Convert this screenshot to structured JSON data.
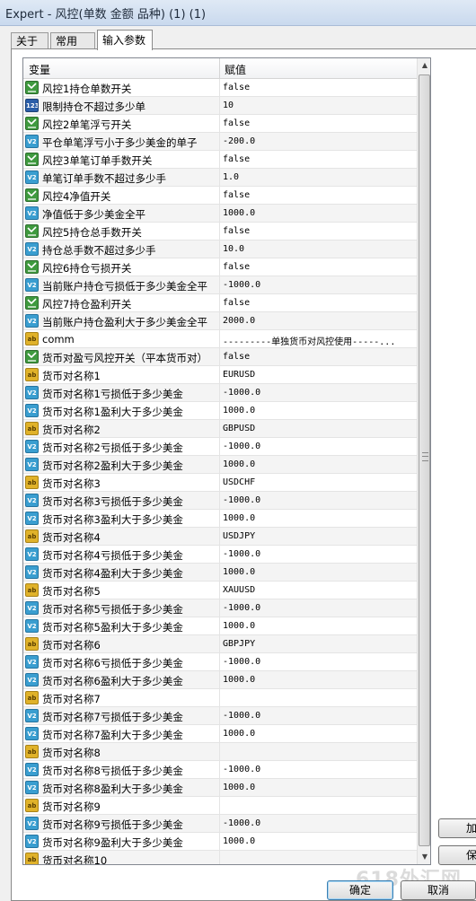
{
  "window": {
    "title": "Expert - 风控(单数 金额 品种) (1) (1)"
  },
  "tabs": [
    "关于",
    "常用",
    "输入参数"
  ],
  "table": {
    "col_variable": "变量",
    "col_value": "赋值",
    "rows": [
      {
        "type": "bool",
        "name": "风控1持仓单数开关",
        "value": "false"
      },
      {
        "type": "int",
        "name": "限制持仓不超过多少单",
        "value": "10"
      },
      {
        "type": "bool",
        "name": "风控2单笔浮亏开关",
        "value": "false"
      },
      {
        "type": "dbl",
        "name": "平仓单笔浮亏小于多少美金的单子",
        "value": "-200.0"
      },
      {
        "type": "bool",
        "name": "风控3单笔订单手数开关",
        "value": "false"
      },
      {
        "type": "dbl",
        "name": "单笔订单手数不超过多少手",
        "value": "1.0"
      },
      {
        "type": "bool",
        "name": "风控4净值开关",
        "value": "false"
      },
      {
        "type": "dbl",
        "name": "净值低于多少美金全平",
        "value": "1000.0"
      },
      {
        "type": "bool",
        "name": "风控5持仓总手数开关",
        "value": "false"
      },
      {
        "type": "dbl",
        "name": "持仓总手数不超过多少手",
        "value": "10.0"
      },
      {
        "type": "bool",
        "name": "风控6持仓亏损开关",
        "value": "false"
      },
      {
        "type": "dbl",
        "name": "当前账户持仓亏损低于多少美金全平",
        "value": "-1000.0"
      },
      {
        "type": "bool",
        "name": "风控7持仓盈利开关",
        "value": "false"
      },
      {
        "type": "dbl",
        "name": "当前账户持仓盈利大于多少美金全平",
        "value": "2000.0"
      },
      {
        "type": "str",
        "name": "comm",
        "value": "---------单独货币对风控使用-----..."
      },
      {
        "type": "bool",
        "name": "货币对盈亏风控开关（平本货币对）",
        "value": "false"
      },
      {
        "type": "str",
        "name": "货币对名称1",
        "value": "EURUSD"
      },
      {
        "type": "dbl",
        "name": "货币对名称1亏损低于多少美金",
        "value": "-1000.0"
      },
      {
        "type": "dbl",
        "name": "货币对名称1盈利大于多少美金",
        "value": "1000.0"
      },
      {
        "type": "str",
        "name": "货币对名称2",
        "value": "GBPUSD"
      },
      {
        "type": "dbl",
        "name": "货币对名称2亏损低于多少美金",
        "value": "-1000.0"
      },
      {
        "type": "dbl",
        "name": "货币对名称2盈利大于多少美金",
        "value": "1000.0"
      },
      {
        "type": "str",
        "name": "货币对名称3",
        "value": "USDCHF"
      },
      {
        "type": "dbl",
        "name": "货币对名称3亏损低于多少美金",
        "value": "-1000.0"
      },
      {
        "type": "dbl",
        "name": "货币对名称3盈利大于多少美金",
        "value": "1000.0"
      },
      {
        "type": "str",
        "name": "货币对名称4",
        "value": "USDJPY"
      },
      {
        "type": "dbl",
        "name": "货币对名称4亏损低于多少美金",
        "value": "-1000.0"
      },
      {
        "type": "dbl",
        "name": "货币对名称4盈利大于多少美金",
        "value": "1000.0"
      },
      {
        "type": "str",
        "name": "货币对名称5",
        "value": "XAUUSD"
      },
      {
        "type": "dbl",
        "name": "货币对名称5亏损低于多少美金",
        "value": "-1000.0"
      },
      {
        "type": "dbl",
        "name": "货币对名称5盈利大于多少美金",
        "value": "1000.0"
      },
      {
        "type": "str",
        "name": "货币对名称6",
        "value": "GBPJPY"
      },
      {
        "type": "dbl",
        "name": "货币对名称6亏损低于多少美金",
        "value": "-1000.0"
      },
      {
        "type": "dbl",
        "name": "货币对名称6盈利大于多少美金",
        "value": "1000.0"
      },
      {
        "type": "str",
        "name": "货币对名称7",
        "value": ""
      },
      {
        "type": "dbl",
        "name": "货币对名称7亏损低于多少美金",
        "value": "-1000.0"
      },
      {
        "type": "dbl",
        "name": "货币对名称7盈利大于多少美金",
        "value": "1000.0"
      },
      {
        "type": "str",
        "name": "货币对名称8",
        "value": ""
      },
      {
        "type": "dbl",
        "name": "货币对名称8亏损低于多少美金",
        "value": "-1000.0"
      },
      {
        "type": "dbl",
        "name": "货币对名称8盈利大于多少美金",
        "value": "1000.0"
      },
      {
        "type": "str",
        "name": "货币对名称9",
        "value": ""
      },
      {
        "type": "dbl",
        "name": "货币对名称9亏损低于多少美金",
        "value": "-1000.0"
      },
      {
        "type": "dbl",
        "name": "货币对名称9盈利大于多少美金",
        "value": "1000.0"
      },
      {
        "type": "str",
        "name": "货币对名称10",
        "value": ""
      }
    ]
  },
  "icon_labels": {
    "bool": "",
    "int": "123",
    "dbl": "V2",
    "str": "ab"
  },
  "side_buttons": {
    "load": "加",
    "save": "保"
  },
  "buttons": {
    "ok": "确定",
    "cancel": "取消"
  },
  "watermark": "618外汇网"
}
